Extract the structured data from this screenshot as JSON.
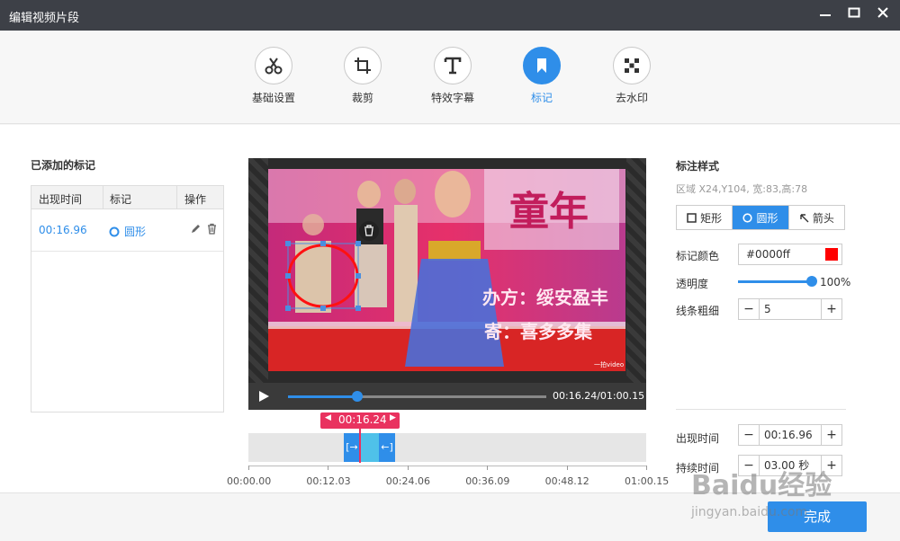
{
  "window": {
    "title": "编辑视频片段",
    "controls": [
      "minimize-icon",
      "maximize-icon",
      "close-icon"
    ]
  },
  "toolbar": {
    "tools": [
      {
        "label": "基础设置",
        "icon": "scissors-icon"
      },
      {
        "label": "裁剪",
        "icon": "crop-icon"
      },
      {
        "label": "特效字幕",
        "icon": "text-t-icon"
      },
      {
        "label": "标记",
        "icon": "bookmark-icon",
        "active": true
      },
      {
        "label": "去水印",
        "icon": "mosaic-icon"
      }
    ]
  },
  "marks_panel": {
    "title": "已添加的标记",
    "columns": [
      "出现时间",
      "标记",
      "操作"
    ],
    "rows": [
      {
        "time": "00:16.96",
        "mark": "圆形",
        "actions": [
          "edit-icon",
          "delete-icon"
        ]
      }
    ]
  },
  "player": {
    "video_text_1": "童年",
    "video_text_2": "办方：绥安盈丰",
    "video_text_3": "寄：喜多多集",
    "video_watermark": "一拍video",
    "time_display": "00:16.24/01:00.15",
    "progress": 0.27
  },
  "timeline": {
    "cursor_time": "00:16.24",
    "ticks": [
      "00:00.00",
      "00:12.03",
      "00:24.06",
      "00:36.09",
      "00:48.12",
      "01:00.15"
    ]
  },
  "style_panel": {
    "title": "标注样式",
    "region_info": "区域 X24,Y104, 宽:83,高:78",
    "shapes": [
      {
        "label": "矩形",
        "icon": "square-icon"
      },
      {
        "label": "圆形",
        "icon": "circle-icon",
        "active": true
      },
      {
        "label": "箭头",
        "icon": "arrow-icon"
      }
    ],
    "color_label": "标记颜色",
    "color_value": "#0000ff",
    "swatch_color": "#ff0000",
    "opacity_label": "透明度",
    "opacity_value": "100%",
    "opacity_level": 1.0,
    "line_width_label": "线条粗细",
    "line_width_value": "5",
    "appear_time_label": "出现时间",
    "appear_time_value": "00:16.96",
    "duration_label": "持续时间",
    "duration_value": "03.00",
    "duration_unit": "秒"
  },
  "footer": {
    "done_label": "完成"
  },
  "watermark": {
    "brand": "Baidu经验",
    "url": "jingyan.baidu.com"
  },
  "colors": {
    "accent": "#2f8ee9",
    "titlebar": "#3d4047",
    "marker": "#ff0000",
    "cursor": "#e9325f"
  }
}
